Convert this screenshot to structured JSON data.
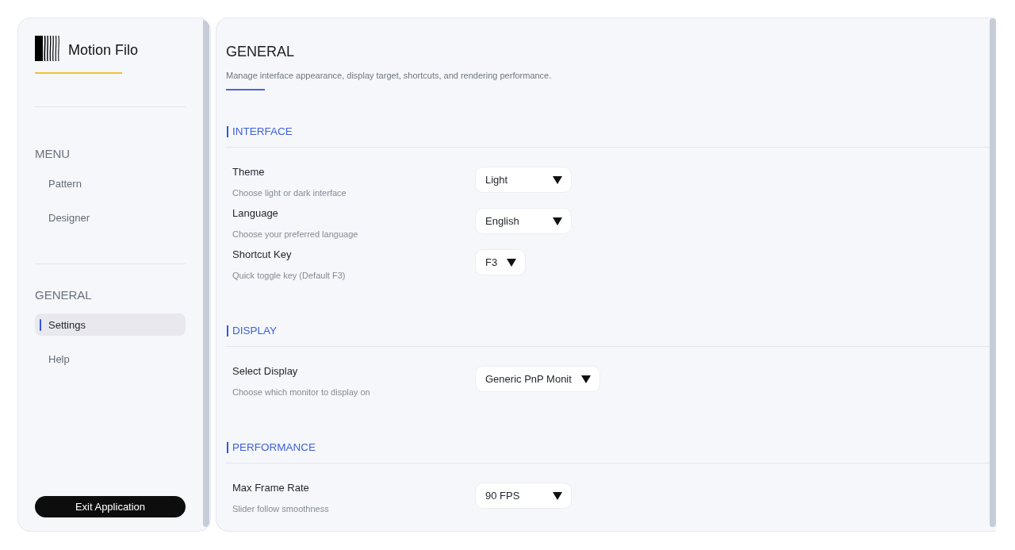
{
  "app": {
    "name": "Motion Filo"
  },
  "sidebar": {
    "groups": [
      {
        "title": "MENU",
        "items": [
          {
            "label": "Pattern",
            "selected": false
          },
          {
            "label": "Designer",
            "selected": false
          }
        ]
      },
      {
        "title": "GENERAL",
        "items": [
          {
            "label": "Settings",
            "selected": true
          },
          {
            "label": "Help",
            "selected": false
          }
        ]
      }
    ],
    "exit_button": "Exit Application"
  },
  "page": {
    "title": "GENERAL",
    "description": "Manage interface appearance, display target, shortcuts, and rendering performance."
  },
  "sections": [
    {
      "title": "INTERFACE",
      "settings": [
        {
          "label": "Theme",
          "description": "Choose light or dark interface",
          "value": "Light"
        },
        {
          "label": "Language",
          "description": "Choose your preferred language",
          "value": "English"
        },
        {
          "label": "Shortcut Key",
          "description": "Quick toggle key (Default F3)",
          "value": "F3"
        }
      ]
    },
    {
      "title": "DISPLAY",
      "settings": [
        {
          "label": "Select Display",
          "description": "Choose which monitor to display on",
          "value": "Generic PnP Monit"
        }
      ]
    },
    {
      "title": "PERFORMANCE",
      "settings": [
        {
          "label": "Max Frame Rate",
          "description": "Slider follow smoothness",
          "value": "90 FPS"
        }
      ]
    }
  ]
}
